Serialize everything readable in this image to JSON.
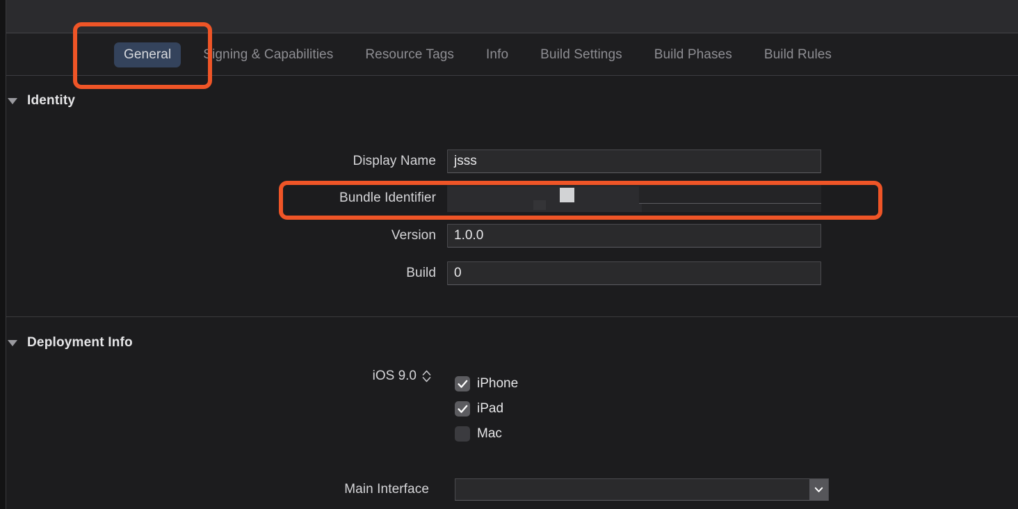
{
  "window": {
    "background_color": "#1c1c1e",
    "accent_color": "#34435c",
    "annotation_color": "#ef5527"
  },
  "tabs": [
    {
      "label": "General",
      "active": true
    },
    {
      "label": "Signing & Capabilities",
      "active": false
    },
    {
      "label": "Resource Tags",
      "active": false
    },
    {
      "label": "Info",
      "active": false
    },
    {
      "label": "Build Settings",
      "active": false
    },
    {
      "label": "Build Phases",
      "active": false
    },
    {
      "label": "Build Rules",
      "active": false
    }
  ],
  "sections": {
    "identity": {
      "title": "Identity",
      "disclosure_icon": "triangle-down-icon",
      "fields": [
        {
          "label": "Display Name",
          "value": "jsss"
        },
        {
          "label": "Bundle Identifier",
          "value": "",
          "redacted": true
        },
        {
          "label": "Version",
          "value": "1.0.0"
        },
        {
          "label": "Build",
          "value": "0"
        }
      ]
    },
    "deployment_info": {
      "title": "Deployment Info",
      "disclosure_icon": "triangle-down-icon",
      "deployment_target": {
        "value": "iOS 9.0",
        "stepper_icon": "stepper-up-down-icon"
      },
      "devices": [
        {
          "label": "iPhone",
          "checked": true
        },
        {
          "label": "iPad",
          "checked": true
        },
        {
          "label": "Mac",
          "checked": false
        }
      ],
      "main_interface": {
        "label": "Main Interface",
        "value": "",
        "dropdown_icon": "chevron-down-icon"
      }
    }
  },
  "annotations": [
    {
      "name": "general-tab-highlight"
    },
    {
      "name": "bundle-identifier-highlight"
    }
  ]
}
